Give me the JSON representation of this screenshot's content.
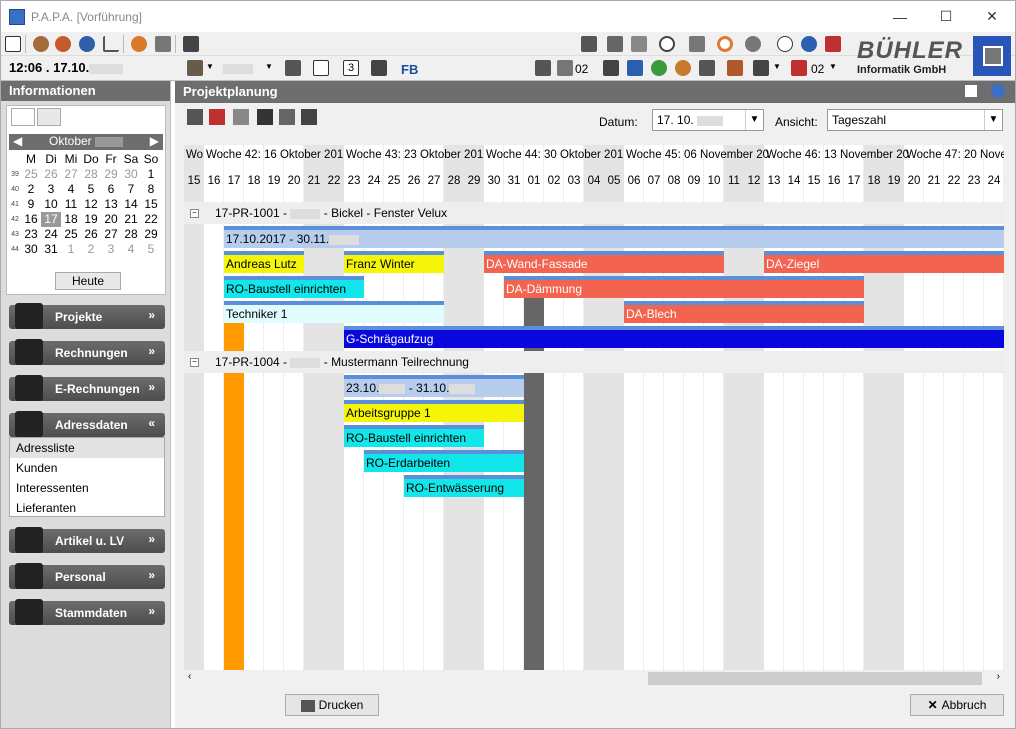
{
  "window": {
    "title": "P.A.P.A. [Vorführung]"
  },
  "toolbar": {
    "date_time": "12:06 . 17.10.",
    "page_num": "3",
    "fb_label": "FB",
    "count1": "02",
    "count2": "02"
  },
  "logo": {
    "line1": "BÜHLER",
    "line2": "Informatik GmbH"
  },
  "sidebar": {
    "title": "Informationen",
    "calendar": {
      "month": "Oktober",
      "weekdays": [
        "M",
        "Di",
        "Mi",
        "Do",
        "Fr",
        "Sa",
        "So"
      ],
      "weeks": [
        {
          "wk": "39",
          "days": [
            "25",
            "26",
            "27",
            "28",
            "29",
            "30",
            "1"
          ]
        },
        {
          "wk": "40",
          "days": [
            "2",
            "3",
            "4",
            "5",
            "6",
            "7",
            "8"
          ]
        },
        {
          "wk": "41",
          "days": [
            "9",
            "10",
            "11",
            "12",
            "13",
            "14",
            "15"
          ]
        },
        {
          "wk": "42",
          "days": [
            "16",
            "17",
            "18",
            "19",
            "20",
            "21",
            "22"
          ]
        },
        {
          "wk": "43",
          "days": [
            "23",
            "24",
            "25",
            "26",
            "27",
            "28",
            "29"
          ]
        },
        {
          "wk": "44",
          "days": [
            "30",
            "31",
            "1",
            "2",
            "3",
            "4",
            "5"
          ]
        }
      ],
      "today_label": "Heute"
    },
    "nav": [
      {
        "label": "Projekte"
      },
      {
        "label": "Rechnungen"
      },
      {
        "label": "E-Rechnungen"
      },
      {
        "label": "Adressdaten"
      },
      {
        "label": "Artikel u. LV"
      },
      {
        "label": "Personal"
      },
      {
        "label": "Stammdaten"
      }
    ],
    "sub_items": [
      "Adressliste",
      "Kunden",
      "Interessenten",
      "Lieferanten"
    ]
  },
  "main": {
    "title": "Projektplanung",
    "datum_label": "Datum:",
    "datum_value": "17. 10.",
    "ansicht_label": "Ansicht:",
    "ansicht_value": "Tageszahl",
    "weeks": [
      "Wo",
      "Woche 42: 16 Oktober 201",
      "Woche 43: 23 Oktober 201",
      "Woche 44: 30 Oktober 201",
      "Woche 45: 06 November 20",
      "Woche 46: 13 November 20",
      "Woche 47: 20 Nove"
    ],
    "days": [
      "15",
      "16",
      "17",
      "18",
      "19",
      "20",
      "21",
      "22",
      "23",
      "24",
      "25",
      "26",
      "27",
      "28",
      "29",
      "30",
      "31",
      "01",
      "02",
      "03",
      "04",
      "05",
      "06",
      "07",
      "08",
      "09",
      "10",
      "11",
      "12",
      "13",
      "14",
      "15",
      "16",
      "17",
      "18",
      "19",
      "20",
      "21",
      "22",
      "23",
      "24"
    ],
    "projects": [
      {
        "label": "17-PR-1001 -",
        "label2": "- Bickel - Fenster Velux"
      },
      {
        "label": "17-PR-1004 -",
        "label2": "- Mustermann Teilrechnung"
      }
    ],
    "bars": {
      "p1_range": "17.10.2017 - 30.11.",
      "andreas": "Andreas Lutz",
      "franz": "Franz Winter",
      "da_wand": "DA-Wand-Fassade",
      "da_ziegel": "DA-Ziegel",
      "ro_baustell": "RO-Baustell einrichten",
      "da_daemmung": "DA-Dämmung",
      "techniker": "Techniker 1",
      "da_blech": "DA-Blech",
      "g_schraeg": "G-Schrägaufzug",
      "p2_range_a": "23.10.",
      "p2_range_b": " - 31.10.",
      "arbeitsgruppe": "Arbeitsgruppe 1",
      "ro_baustell2": "RO-Baustell einrichten",
      "ro_erd": "RO-Erdarbeiten",
      "ro_entw": "RO-Entwässerung"
    },
    "buttons": {
      "drucken": "Drucken",
      "abbruch": "Abbruch"
    }
  }
}
